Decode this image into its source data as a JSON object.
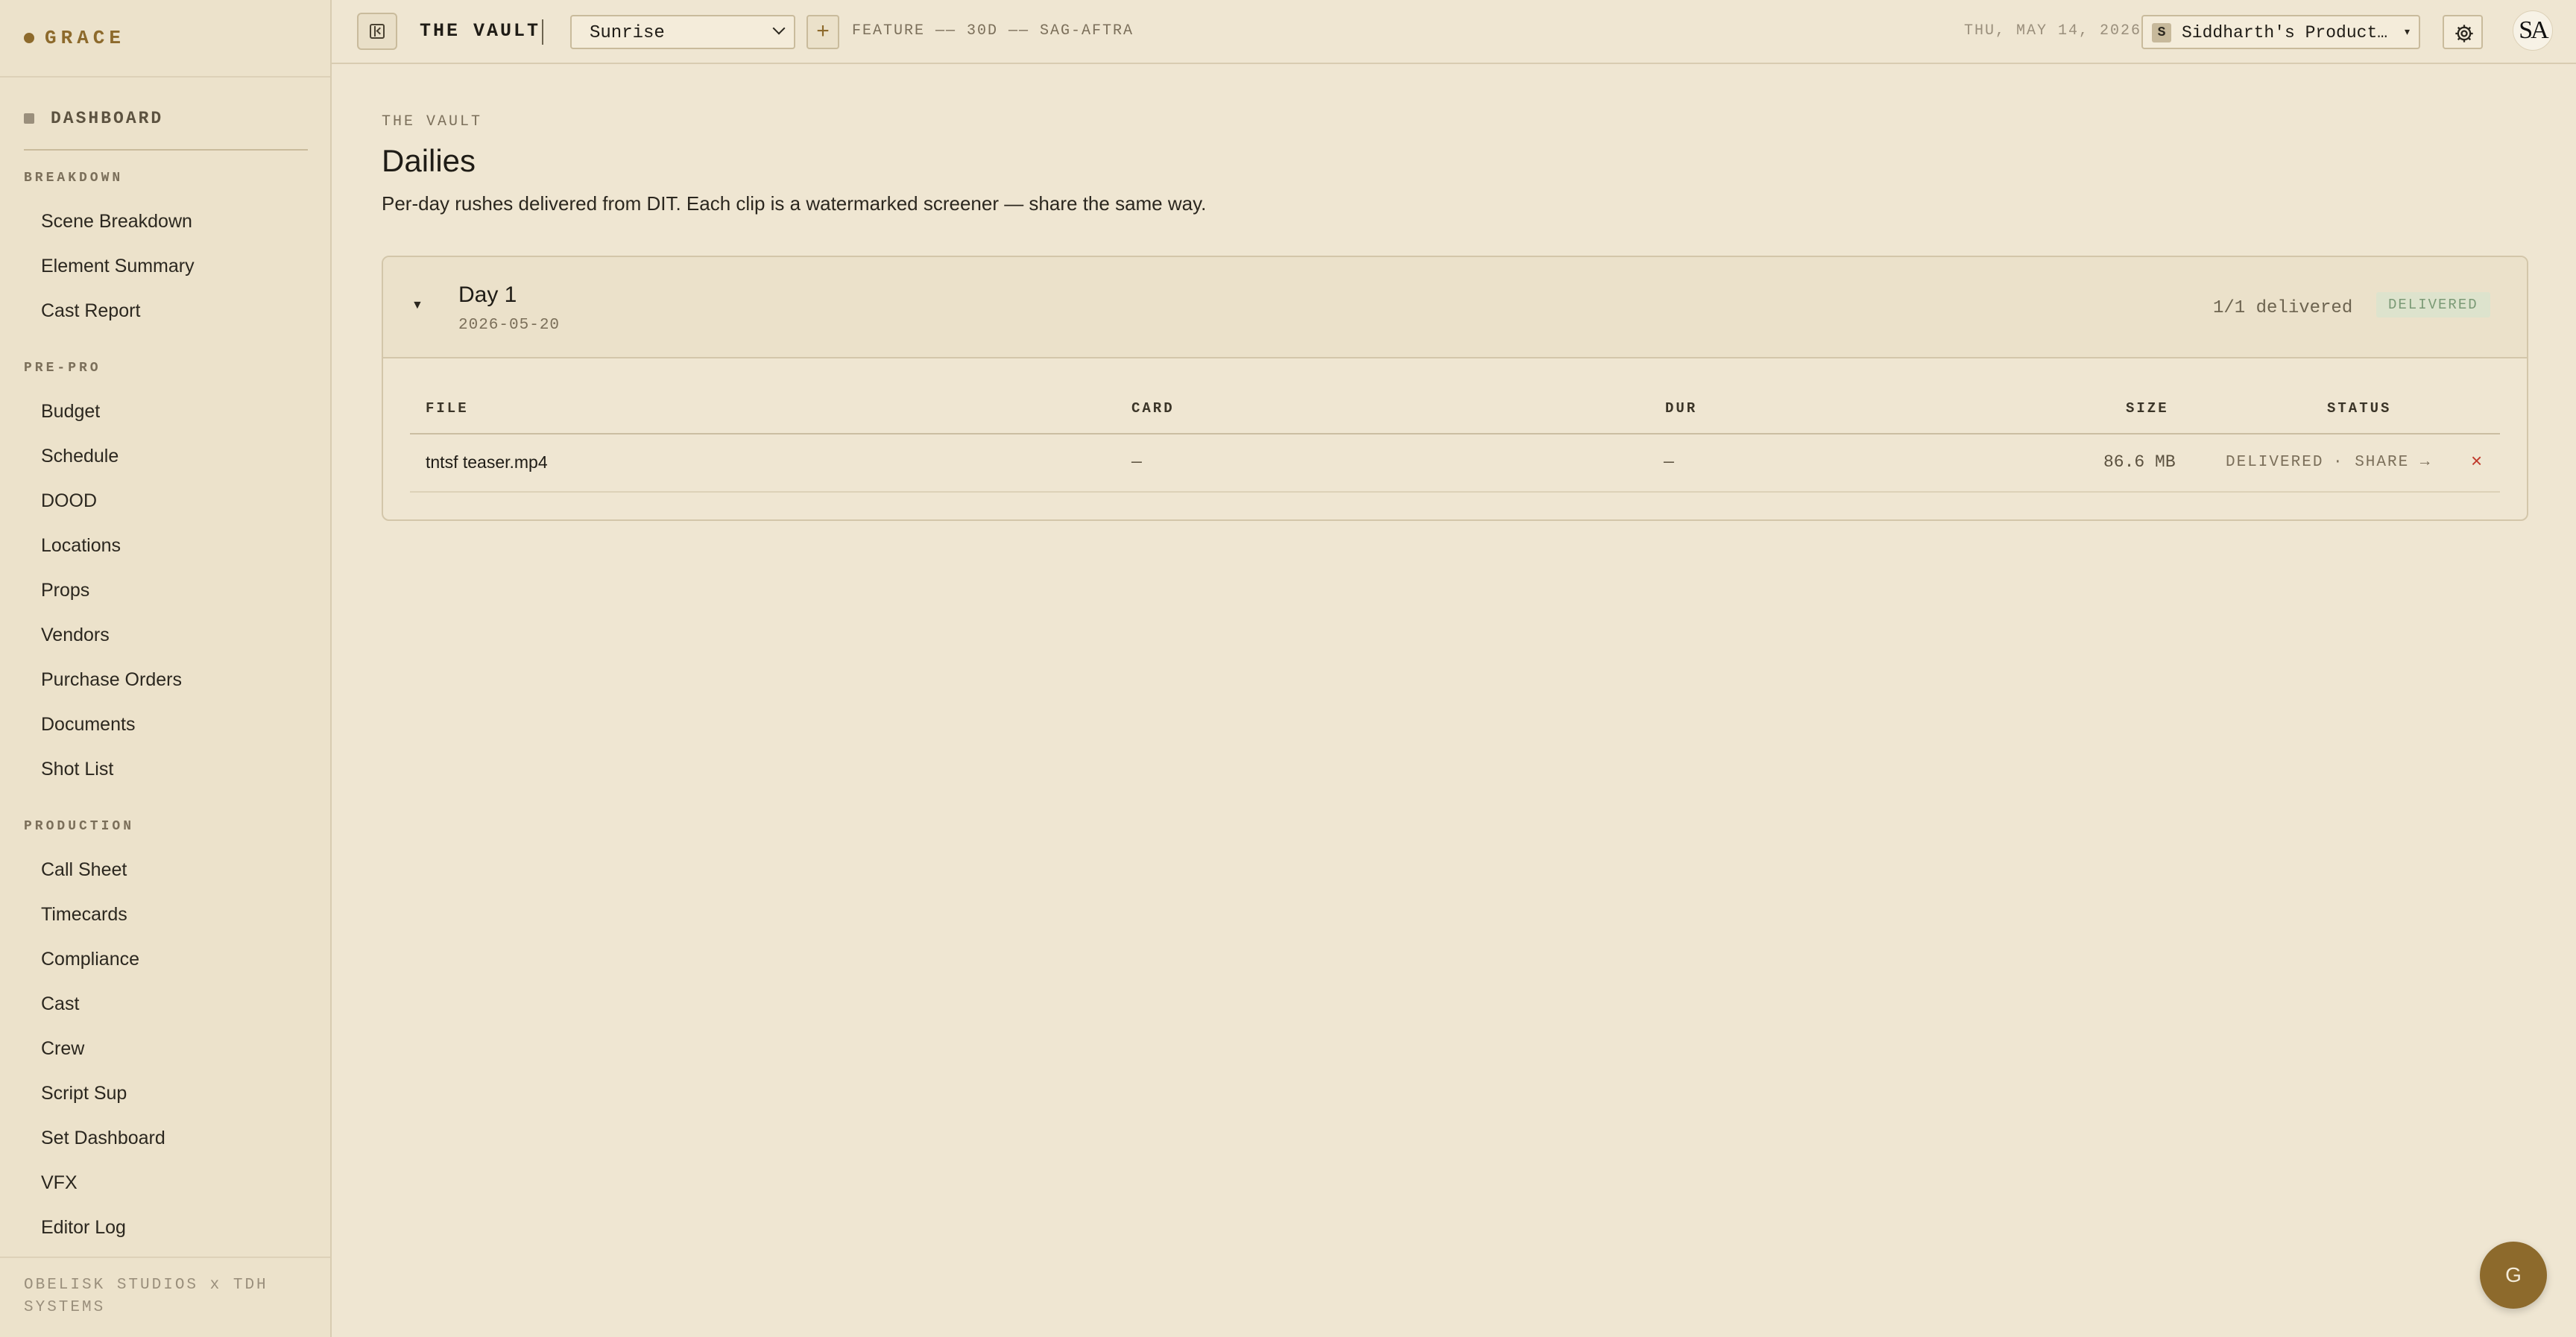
{
  "brand": {
    "name": "GRACE"
  },
  "sidebar": {
    "dashboard": "DASHBOARD",
    "sections": [
      {
        "title": "BREAKDOWN",
        "items": [
          "Scene Breakdown",
          "Element Summary",
          "Cast Report"
        ]
      },
      {
        "title": "PRE-PRO",
        "items": [
          "Budget",
          "Schedule",
          "DOOD",
          "Locations",
          "Props",
          "Vendors",
          "Purchase Orders",
          "Documents",
          "Shot List"
        ]
      },
      {
        "title": "PRODUCTION",
        "items": [
          "Call Sheet",
          "Timecards",
          "Compliance",
          "Cast",
          "Crew",
          "Script Sup",
          "Set Dashboard",
          "VFX",
          "Editor Log"
        ]
      }
    ],
    "footer": "OBELISK STUDIOS x TDH SYSTEMS"
  },
  "topbar": {
    "title": "THE VAULT",
    "project": "Sunrise",
    "meta": "FEATURE —— 30D —— SAG-AFTRA",
    "date": "THU, MAY 14, 2026",
    "org_initial": "S",
    "org_name": "Siddharth's Productions",
    "user_initials": "SA"
  },
  "page": {
    "eyebrow": "THE VAULT",
    "title": "Dailies",
    "subtitle": "Per-day rushes delivered from DIT. Each clip is a watermarked screener — share the same way."
  },
  "day": {
    "title": "Day 1",
    "date": "2026-05-20",
    "count": "1/1 delivered",
    "badge": "DELIVERED",
    "columns": {
      "file": "FILE",
      "card": "CARD",
      "dur": "DUR",
      "size": "SIZE",
      "status": "STATUS"
    },
    "rows": [
      {
        "file": "tntsf teaser.mp4",
        "card": "—",
        "dur": "—",
        "size": "86.6 MB",
        "status": "DELIVERED",
        "share": "· SHARE →",
        "delete": "×"
      }
    ]
  },
  "fab": {
    "label": "G"
  },
  "colors": {
    "accent": "#8d6a2c",
    "background": "#efe6d2",
    "sidebar": "#ece2cb",
    "delete": "#c0392b",
    "badge_bg": "#dde3cd",
    "badge_fg": "#7b9a76"
  }
}
